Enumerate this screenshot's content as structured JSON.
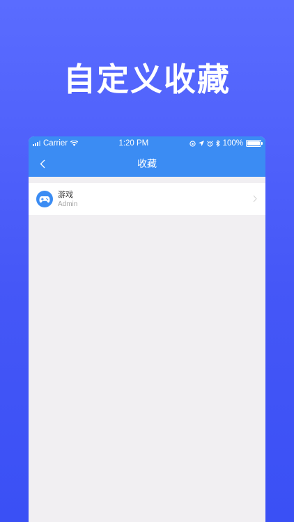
{
  "headline": "自定义收藏",
  "status_bar": {
    "carrier": "Carrier",
    "time": "1:20 PM",
    "battery": "100%",
    "icons": [
      "signal-icon",
      "wifi-icon",
      "orientation-lock-icon",
      "location-icon",
      "alarm-icon",
      "bluetooth-icon",
      "battery-icon"
    ]
  },
  "nav": {
    "back_icon": "chevron-left-icon",
    "title": "收藏"
  },
  "favorites": [
    {
      "title": "游戏",
      "subtitle": "Admin",
      "icon": "gamepad-icon"
    }
  ],
  "colors": {
    "background_gradient_top": "#5a6cff",
    "background_gradient_bottom": "#3a50f5",
    "app_bar": "#3b8cf3",
    "content_bg": "#f1eff2"
  }
}
